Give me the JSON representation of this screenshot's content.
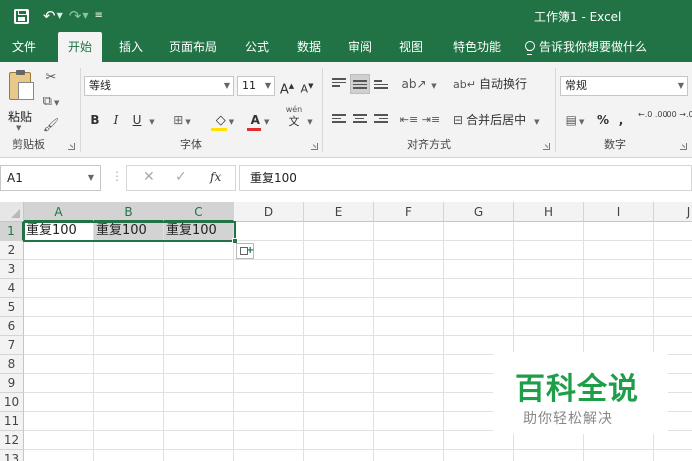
{
  "app": {
    "window_title": "工作簿1 - Excel",
    "brand_color": "#217346"
  },
  "qat": {
    "save_icon": "save-icon",
    "undo_icon": "undo-icon",
    "redo_icon": "redo-icon",
    "customize_icon": "customize-qat-icon"
  },
  "tabs": [
    {
      "label": "文件"
    },
    {
      "label": "开始",
      "active": true
    },
    {
      "label": "插入"
    },
    {
      "label": "页面布局"
    },
    {
      "label": "公式"
    },
    {
      "label": "数据"
    },
    {
      "label": "审阅"
    },
    {
      "label": "视图"
    },
    {
      "label": "特色功能"
    }
  ],
  "tell_me": {
    "placeholder": "告诉我你想要做什么"
  },
  "ribbon": {
    "clipboard": {
      "label": "剪贴板",
      "paste": "粘贴"
    },
    "font": {
      "label": "字体",
      "font_name": "等线",
      "font_size": "11",
      "grow": "A",
      "shrink": "A",
      "bold": "B",
      "italic": "I",
      "underline": "U",
      "font_color_glyph": "A",
      "phonetic_top": "wén",
      "phonetic_bottom": "文"
    },
    "alignment": {
      "label": "对齐方式",
      "wrap_text": "自动换行",
      "merge_center": "合并后居中"
    },
    "number": {
      "label": "数字",
      "format": "常规",
      "percent": "%",
      "comma": ",",
      "inc_decimal": "←.0 .00",
      "dec_decimal": ".00 →.0"
    }
  },
  "formula_bar": {
    "name_box": "A1",
    "fx": "fx",
    "content": "重复100"
  },
  "sheet": {
    "columns": [
      "A",
      "B",
      "C",
      "D",
      "E",
      "F",
      "G",
      "H",
      "I",
      "J"
    ],
    "rows": [
      "1",
      "2",
      "3",
      "4",
      "5",
      "6",
      "7",
      "8",
      "9",
      "10",
      "11",
      "12",
      "13"
    ],
    "cells": {
      "A1": "重复100",
      "B1": "重复100",
      "C1": "重复100"
    }
  },
  "watermark": {
    "title": "百科全说",
    "subtitle": "助你轻松解决"
  }
}
